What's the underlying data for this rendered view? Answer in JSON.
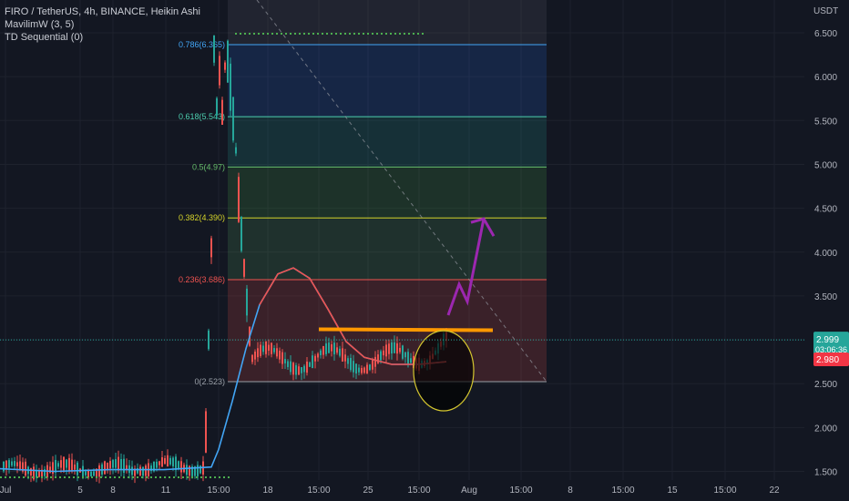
{
  "header": {
    "symbol": "FIRO / TetherUS, 4h, BINANCE, Heikin Ashi",
    "indicators": [
      "MavilimW (3, 5)",
      "TD Sequential (0)"
    ]
  },
  "axis": {
    "currency": "USDT"
  },
  "price_tags": {
    "last_price": "2.999",
    "countdown": "03:06:36",
    "ma_value": "2.980"
  },
  "colors": {
    "background": "#131722",
    "up_candle": "#26a69a",
    "down_candle": "#ef5350",
    "mavilim": "#42a5f5",
    "orange_line": "#ff9800",
    "arrow": "#9c27b0",
    "circle": "#d4c62f"
  },
  "chart_data": {
    "type": "candlestick",
    "title": "FIRO / TetherUS, 4h, BINANCE, Heikin Ashi",
    "ylabel": "USDT",
    "ylim": [
      1.4,
      6.8
    ],
    "y_ticks": [
      "1.500",
      "2.000",
      "2.500",
      "3.000",
      "3.500",
      "4.000",
      "4.500",
      "5.000",
      "5.500",
      "6.000",
      "6.500"
    ],
    "x_ticks": [
      "Jul",
      "5",
      "8",
      "11",
      "15:00",
      "18",
      "15:00",
      "25",
      "15:00",
      "Aug",
      "15:00",
      "8",
      "15:00",
      "15",
      "15:00",
      "22"
    ],
    "fib_levels": [
      {
        "ratio": "0",
        "price": 2.523,
        "label": "0(2.523)",
        "color": "#9aa0a8"
      },
      {
        "ratio": "0.236",
        "price": 3.686,
        "label": "0.236(3.686)",
        "color": "#ef5350"
      },
      {
        "ratio": "0.382",
        "price": 4.39,
        "label": "0.382(4.390)",
        "color": "#d4d32a"
      },
      {
        "ratio": "0.5",
        "price": 4.97,
        "label": "0.5(4.97)",
        "color": "#66bb6a"
      },
      {
        "ratio": "0.618",
        "price": 5.543,
        "label": "0.618(5.543)",
        "color": "#4dd0b0"
      },
      {
        "ratio": "0.786",
        "price": 6.365,
        "label": "0.786(6.365)",
        "color": "#42a5f5"
      }
    ],
    "last_price": 2.999,
    "ma_value": 2.98,
    "annotations": {
      "resistance_line_price": 3.12,
      "projection_target": 4.38
    }
  }
}
